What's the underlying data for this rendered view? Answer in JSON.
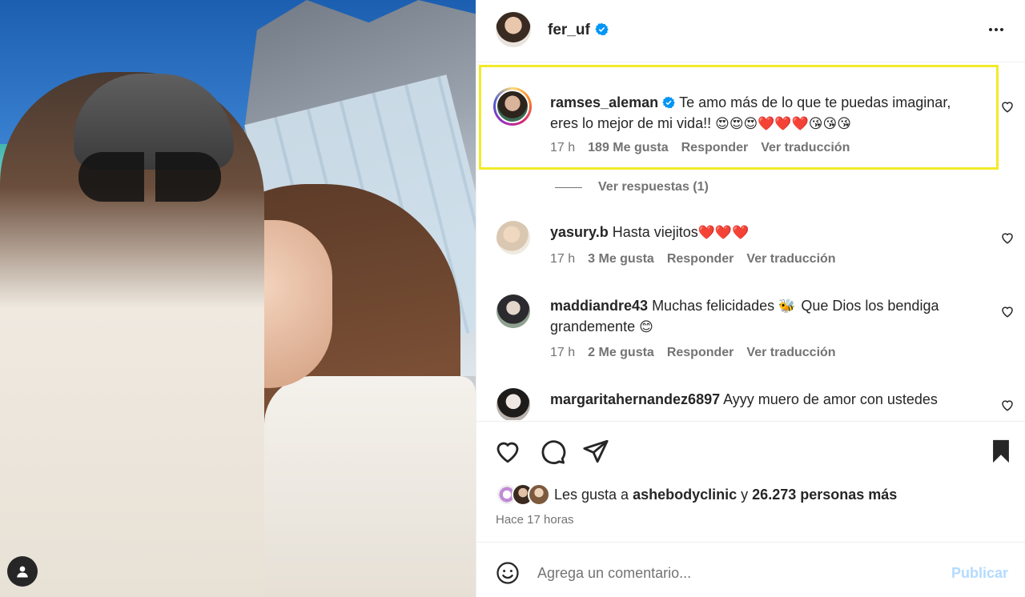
{
  "post": {
    "author": "fer_uf",
    "menu_icon": "more-horizontal-icon"
  },
  "comments": [
    {
      "user": "ramses_aleman",
      "verified": true,
      "text": "Te amo más de lo que te puedas imaginar, eres lo mejor de mi vida!!",
      "emojis": "😍😍😍❤️❤️❤️😘😘😘",
      "age": "17 h",
      "likes": "189 Me gusta",
      "reply": "Responder",
      "translate": "Ver traducción",
      "replies": "Ver respuestas (1)"
    },
    {
      "user": "yasury.b",
      "text": "Hasta viejitos",
      "emojis": "❤️❤️❤️",
      "age": "17 h",
      "likes": "3 Me gusta",
      "reply": "Responder",
      "translate": "Ver traducción"
    },
    {
      "user": "maddiandre43",
      "text": "Muchas felicidades",
      "emoji_mid": "🐝",
      "text2": "Que Dios los bendiga grandemente",
      "emojis": "😊",
      "age": "17 h",
      "likes": "2 Me gusta",
      "reply": "Responder",
      "translate": "Ver traducción"
    },
    {
      "user": "margaritahernandez6897",
      "text": "Ayyy muero de amor con ustedes"
    }
  ],
  "likes_summary": {
    "prefix": "Les gusta a",
    "user": "ashebodyclinic",
    "joiner": "y",
    "others": "26.273 personas más"
  },
  "timestamp": "Hace 17 horas",
  "composer": {
    "placeholder": "Agrega un comentario...",
    "publish": "Publicar"
  },
  "colors": {
    "highlight": "#f3ea2a",
    "verified": "#0095f6",
    "heart_red": "#ff3040",
    "publish_disabled": "#b3dbff"
  }
}
